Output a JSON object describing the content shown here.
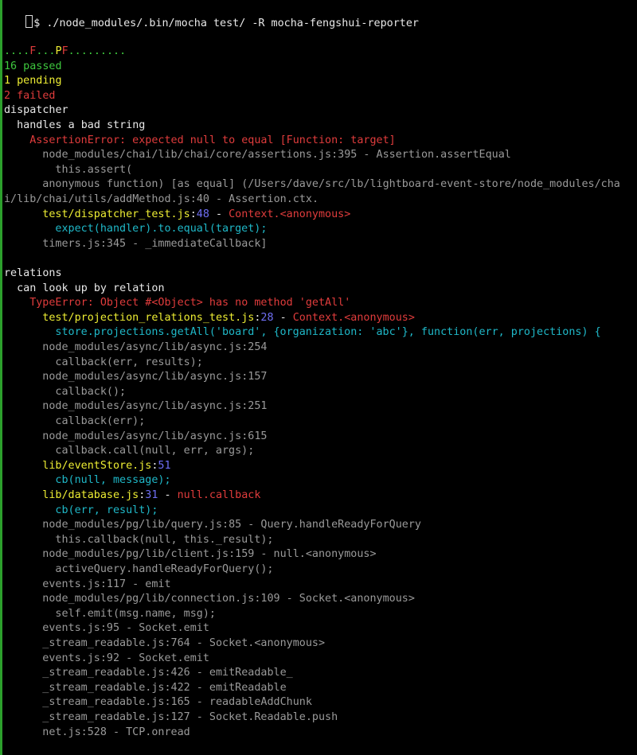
{
  "colors": {
    "background": "#000000",
    "default": "#e8e8e8",
    "gray": "#9a9a9a",
    "green": "#3ec83e",
    "yellow": "#eded33",
    "red": "#e03c3c",
    "cyan": "#1fb8c8",
    "blue": "#6f6ff5",
    "gutter": "#2ca02c"
  },
  "terminal": {
    "command": "$ ./node_modules/.bin/mocha test/ -R mocha-fengshui-reporter",
    "lines": [
      {
        "indent": 0,
        "spans": [
          {
            "text": "....",
            "color": "green"
          },
          {
            "text": "F",
            "color": "red"
          },
          {
            "text": "...",
            "color": "green"
          },
          {
            "text": "P",
            "color": "yellow"
          },
          {
            "text": "F",
            "color": "red"
          },
          {
            "text": ".........",
            "color": "green"
          }
        ]
      },
      {
        "indent": 0,
        "spans": [
          {
            "text": "16 passed",
            "color": "green"
          }
        ]
      },
      {
        "indent": 0,
        "spans": [
          {
            "text": "1 pending",
            "color": "yellow"
          }
        ]
      },
      {
        "indent": 0,
        "spans": [
          {
            "text": "2 failed",
            "color": "red"
          }
        ]
      },
      {
        "indent": 0,
        "spans": [
          {
            "text": "dispatcher",
            "color": "default"
          }
        ]
      },
      {
        "indent": 2,
        "spans": [
          {
            "text": "handles a bad string",
            "color": "default"
          }
        ]
      },
      {
        "indent": 4,
        "spans": [
          {
            "text": "AssertionError: expected null to equal [Function: target]",
            "color": "red"
          }
        ]
      },
      {
        "indent": 6,
        "spans": [
          {
            "text": "node_modules/chai/lib/chai/core/assertions.js:395 - Assertion.assertEqual",
            "color": "gray"
          }
        ]
      },
      {
        "indent": 8,
        "spans": [
          {
            "text": "this.assert(",
            "color": "gray"
          }
        ]
      },
      {
        "indent": 6,
        "spans": [
          {
            "text": "anonymous function) [as equal] (/Users/dave/src/lb/lightboard-event-store/node_modules/cha",
            "color": "gray"
          }
        ]
      },
      {
        "indent": 0,
        "spans": [
          {
            "text": "i/lib/chai/utils/addMethod.js:40 - Assertion.ctx.",
            "color": "gray"
          }
        ]
      },
      {
        "indent": 6,
        "spans": [
          {
            "text": "test/dispatcher_test.js",
            "color": "yellow"
          },
          {
            "text": ":",
            "color": "default"
          },
          {
            "text": "48",
            "color": "blue"
          },
          {
            "text": " - ",
            "color": "default"
          },
          {
            "text": "Context.<anonymous>",
            "color": "red"
          }
        ]
      },
      {
        "indent": 8,
        "spans": [
          {
            "text": "expect(handler).to.equal(target);",
            "color": "cyan"
          }
        ]
      },
      {
        "indent": 6,
        "spans": [
          {
            "text": "timers.js:345 - _immediateCallback]",
            "color": "gray"
          }
        ]
      },
      {
        "indent": 0,
        "spans": [
          {
            "text": "",
            "color": "default"
          }
        ]
      },
      {
        "indent": 0,
        "spans": [
          {
            "text": "relations",
            "color": "default"
          }
        ]
      },
      {
        "indent": 2,
        "spans": [
          {
            "text": "can look up by relation",
            "color": "default"
          }
        ]
      },
      {
        "indent": 4,
        "spans": [
          {
            "text": "TypeError: Object #<Object> has no method 'getAll'",
            "color": "red"
          }
        ]
      },
      {
        "indent": 6,
        "spans": [
          {
            "text": "test/projection_relations_test.js",
            "color": "yellow"
          },
          {
            "text": ":",
            "color": "default"
          },
          {
            "text": "28",
            "color": "blue"
          },
          {
            "text": " - ",
            "color": "default"
          },
          {
            "text": "Context.<anonymous>",
            "color": "red"
          }
        ]
      },
      {
        "indent": 8,
        "spans": [
          {
            "text": "store.projections.getAll('board', {organization: 'abc'}, function(err, projections) {",
            "color": "cyan"
          }
        ]
      },
      {
        "indent": 6,
        "spans": [
          {
            "text": "node_modules/async/lib/async.js:254",
            "color": "gray"
          }
        ]
      },
      {
        "indent": 8,
        "spans": [
          {
            "text": "callback(err, results);",
            "color": "gray"
          }
        ]
      },
      {
        "indent": 6,
        "spans": [
          {
            "text": "node_modules/async/lib/async.js:157",
            "color": "gray"
          }
        ]
      },
      {
        "indent": 8,
        "spans": [
          {
            "text": "callback();",
            "color": "gray"
          }
        ]
      },
      {
        "indent": 6,
        "spans": [
          {
            "text": "node_modules/async/lib/async.js:251",
            "color": "gray"
          }
        ]
      },
      {
        "indent": 8,
        "spans": [
          {
            "text": "callback(err);",
            "color": "gray"
          }
        ]
      },
      {
        "indent": 6,
        "spans": [
          {
            "text": "node_modules/async/lib/async.js:615",
            "color": "gray"
          }
        ]
      },
      {
        "indent": 8,
        "spans": [
          {
            "text": "callback.call(null, err, args);",
            "color": "gray"
          }
        ]
      },
      {
        "indent": 6,
        "spans": [
          {
            "text": "lib/eventStore.js",
            "color": "yellow"
          },
          {
            "text": ":",
            "color": "default"
          },
          {
            "text": "51",
            "color": "blue"
          }
        ]
      },
      {
        "indent": 8,
        "spans": [
          {
            "text": "cb(null, message);",
            "color": "cyan"
          }
        ]
      },
      {
        "indent": 6,
        "spans": [
          {
            "text": "lib/database.js",
            "color": "yellow"
          },
          {
            "text": ":",
            "color": "default"
          },
          {
            "text": "31",
            "color": "blue"
          },
          {
            "text": " - ",
            "color": "default"
          },
          {
            "text": "null.callback",
            "color": "red"
          }
        ]
      },
      {
        "indent": 8,
        "spans": [
          {
            "text": "cb(err, result);",
            "color": "cyan"
          }
        ]
      },
      {
        "indent": 6,
        "spans": [
          {
            "text": "node_modules/pg/lib/query.js:85 - Query.handleReadyForQuery",
            "color": "gray"
          }
        ]
      },
      {
        "indent": 8,
        "spans": [
          {
            "text": "this.callback(null, this._result);",
            "color": "gray"
          }
        ]
      },
      {
        "indent": 6,
        "spans": [
          {
            "text": "node_modules/pg/lib/client.js:159 - null.<anonymous>",
            "color": "gray"
          }
        ]
      },
      {
        "indent": 8,
        "spans": [
          {
            "text": "activeQuery.handleReadyForQuery();",
            "color": "gray"
          }
        ]
      },
      {
        "indent": 6,
        "spans": [
          {
            "text": "events.js:117 - emit",
            "color": "gray"
          }
        ]
      },
      {
        "indent": 6,
        "spans": [
          {
            "text": "node_modules/pg/lib/connection.js:109 - Socket.<anonymous>",
            "color": "gray"
          }
        ]
      },
      {
        "indent": 8,
        "spans": [
          {
            "text": "self.emit(msg.name, msg);",
            "color": "gray"
          }
        ]
      },
      {
        "indent": 6,
        "spans": [
          {
            "text": "events.js:95 - Socket.emit",
            "color": "gray"
          }
        ]
      },
      {
        "indent": 6,
        "spans": [
          {
            "text": "_stream_readable.js:764 - Socket.<anonymous>",
            "color": "gray"
          }
        ]
      },
      {
        "indent": 6,
        "spans": [
          {
            "text": "events.js:92 - Socket.emit",
            "color": "gray"
          }
        ]
      },
      {
        "indent": 6,
        "spans": [
          {
            "text": "_stream_readable.js:426 - emitReadable_",
            "color": "gray"
          }
        ]
      },
      {
        "indent": 6,
        "spans": [
          {
            "text": "_stream_readable.js:422 - emitReadable",
            "color": "gray"
          }
        ]
      },
      {
        "indent": 6,
        "spans": [
          {
            "text": "_stream_readable.js:165 - readableAddChunk",
            "color": "gray"
          }
        ]
      },
      {
        "indent": 6,
        "spans": [
          {
            "text": "_stream_readable.js:127 - Socket.Readable.push",
            "color": "gray"
          }
        ]
      },
      {
        "indent": 6,
        "spans": [
          {
            "text": "net.js:528 - TCP.onread",
            "color": "gray"
          }
        ]
      }
    ]
  }
}
